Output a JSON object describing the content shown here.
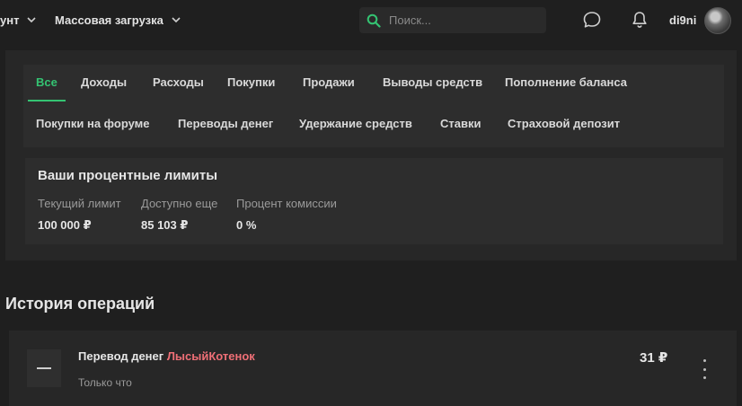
{
  "header": {
    "account_label": "унт",
    "bulk_upload_label": "Массовая загрузка",
    "search_placeholder": "Поиск...",
    "username": "di9ni"
  },
  "tabs": [
    {
      "label": "Все",
      "active": true
    },
    {
      "label": "Доходы"
    },
    {
      "label": "Расходы"
    },
    {
      "label": "Покупки"
    },
    {
      "label": "Продажи"
    },
    {
      "label": "Выводы средств"
    },
    {
      "label": "Пополнение баланса"
    },
    {
      "label": "Покупки на форуме"
    },
    {
      "label": "Переводы денег"
    },
    {
      "label": "Удержание средств"
    },
    {
      "label": "Ставки"
    },
    {
      "label": "Страховой депозит"
    }
  ],
  "limits": {
    "title": "Ваши процентные лимиты",
    "items": [
      {
        "label": "Текущий лимит",
        "value": "100 000 ₽"
      },
      {
        "label": "Доступно еще",
        "value": "85 103 ₽"
      },
      {
        "label": "Процент комиссии",
        "value": "0 %"
      }
    ]
  },
  "history": {
    "title": "История операций",
    "operations": [
      {
        "title": "Перевод денег",
        "user": "ЛысыйКотенок",
        "time": "Только что",
        "amount": "31 ₽"
      }
    ]
  },
  "colors": {
    "accent": "#34c372",
    "user_link": "#ef6f76",
    "background": "#1f1f1f"
  }
}
